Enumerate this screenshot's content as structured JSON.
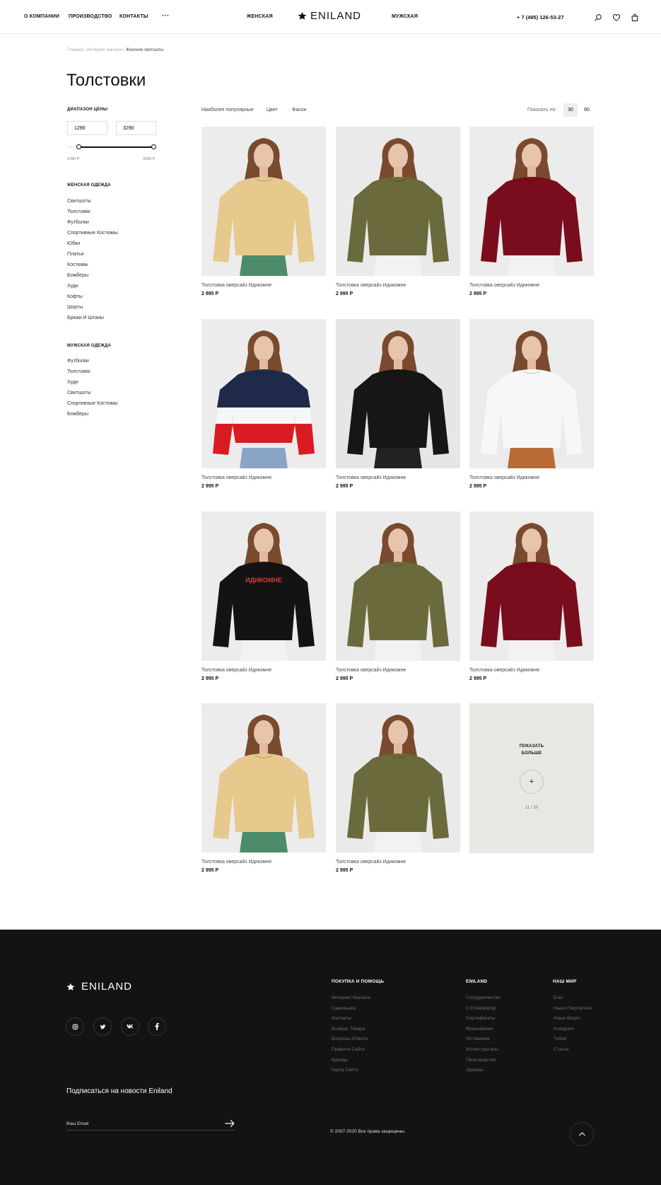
{
  "header": {
    "nav_left": [
      "О КОМПАНИИ",
      "ПРОИЗВОДСТВО",
      "КОНТАКТЫ"
    ],
    "more": "···",
    "women": "ЖЕНСКАЯ",
    "men": "МУЖСКАЯ",
    "brand": "ENILAND",
    "phone": "+ 7 (495) 126-53-27"
  },
  "breadcrumb": {
    "home": "Главная /",
    "shop": "Интернет магазин /",
    "current": "Женские свитшоты"
  },
  "title": "Толстовки",
  "filter": {
    "price_heading": "ДИАПАЗОН ЦЕНЫ",
    "price_from": "1290",
    "price_to": "3290",
    "min_label": "1290 Р",
    "max_label": "3290 Р",
    "slider_range": [
      0.13,
      1.0
    ]
  },
  "women": {
    "heading": "ЖЕНСКАЯ ОДЕЖДА",
    "items": [
      "Свитшоты",
      "Толстовки",
      "Футболки",
      "Спортивные Костюмы",
      "Юбки",
      "Платья",
      "Костюмы",
      "Бомберы",
      "Худи",
      "Кофты",
      "Шорты",
      "Брюки И Штаны"
    ]
  },
  "men": {
    "heading": "МУЖСКАЯ ОДЕЖДА",
    "items": [
      "Футболки",
      "Толстовки",
      "Худи",
      "Свитшоты",
      "Спортивные Костюмы",
      "Бомберы"
    ]
  },
  "sort": {
    "popular": "Наиболее популярные",
    "color": "Цвет",
    "style": "Фасон",
    "show_label": "Показать по:",
    "per_page": [
      "30",
      "60"
    ],
    "active": "30"
  },
  "products": [
    {
      "name": "Толстовка оверсайз Идикомне",
      "price": "2 995 Р",
      "color": "#e7c98e",
      "bg": "#ececec",
      "pants": "#4d8c6b"
    },
    {
      "name": "Толстовка оверсайз Идикомне",
      "price": "2 995 Р",
      "color": "#6b6a3c",
      "bg": "#eaeaea",
      "pants": "#f2f2f2"
    },
    {
      "name": "Толстовка оверсайз Идикомне",
      "price": "2 995 Р",
      "color": "#7a0d1d",
      "bg": "#ececec",
      "pants": "#f2f2f2"
    },
    {
      "name": "Толстовка оверсайз Идикомне",
      "price": "2 995 Р",
      "color": "#1f2a4a",
      "bg": "#ececec",
      "pants": "#8aa4c8",
      "stripes": [
        "#1f2a4a",
        "#f7f7f7",
        "#d91c24"
      ]
    },
    {
      "name": "Толстовка оверсайз Идикомне",
      "price": "2 995 Р",
      "color": "#161616",
      "bg": "#e6e6e6",
      "pants": "#222222"
    },
    {
      "name": "Толстовка оверсайз Идикомне",
      "price": "2 995 Р",
      "color": "#f7f7f7",
      "bg": "#ebebeb",
      "pants": "#b86c35"
    },
    {
      "name": "Толстовка оверсайз Идикомне",
      "price": "2 995 Р",
      "color": "#131313",
      "bg": "#ececec",
      "pants": "#f2f2f2",
      "print": "ИДИКОМНЕ"
    },
    {
      "name": "Толстовка оверсайз Идикомне",
      "price": "2 995 Р",
      "color": "#6b6a3c",
      "bg": "#eaeaea",
      "pants": "#f2f2f2"
    },
    {
      "name": "Толстовка оверсайз Идикомне",
      "price": "2 995 Р",
      "color": "#7a0d1d",
      "bg": "#ececec",
      "pants": "#f2f2f2"
    },
    {
      "name": "Толстовка оверсайз Идикомне",
      "price": "2 995 Р",
      "color": "#e7c98e",
      "bg": "#ececec",
      "pants": "#4d8c6b"
    },
    {
      "name": "Толстовка оверсайз Идикомне",
      "price": "2 995 Р",
      "color": "#6b6a3c",
      "bg": "#eaeaea",
      "pants": "#f2f2f2"
    }
  ],
  "show_more": {
    "line1": "ПОКАЗАТЬ",
    "line2": "БОЛЬШЕ",
    "plus": "+",
    "count": "11 / 30"
  },
  "footer": {
    "brand": "ENILAND",
    "social": [
      "instagram-icon",
      "twitter-icon",
      "vk-icon",
      "facebook-icon"
    ],
    "subscribe": "Подписаться на новости Eniland",
    "email_placeholder": "Ваш Email",
    "col1": {
      "heading": "ПОКУПКА И ПОМОЩЬ",
      "items": [
        "Интернет Магазин",
        "Самовывоз",
        "Контакты",
        "Возврат Товара",
        "Вопросы-Ответы",
        "Правила Сайта",
        "Бренды",
        "Карта Сайта"
      ]
    },
    "col2": {
      "heading": "ENILAND",
      "items": [
        "Сотрудничество",
        "О Enilandshop",
        "Сертификаты",
        "Франчайзинг",
        "Оптовикам",
        "Иллюстраторы",
        "Производство",
        "Одежды"
      ]
    },
    "col3": {
      "heading": "НАШ МИР",
      "items": [
        "Блог",
        "Наши Покупатели",
        "Наши Видео",
        "Instagram",
        "Twitter",
        "Статьи"
      ]
    },
    "copyright": "© 2007-2020 Все права защищены."
  }
}
